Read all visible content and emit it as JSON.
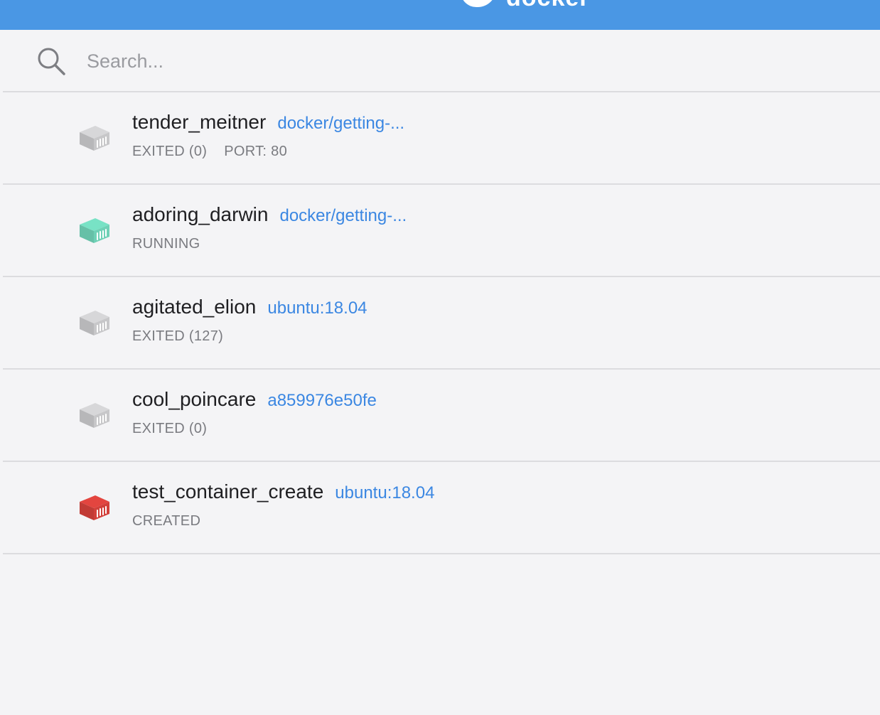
{
  "header": {
    "brand": "docker",
    "color": "#4a97e4"
  },
  "search": {
    "placeholder": "Search...",
    "value": ""
  },
  "containers": [
    {
      "name": "tender_meitner",
      "image": "docker/getting-...",
      "status": "EXITED (0)",
      "port": "PORT: 80",
      "icon": "container-icon",
      "color": "#c7c7c9"
    },
    {
      "name": "adoring_darwin",
      "image": "docker/getting-...",
      "status": "RUNNING",
      "port": "",
      "icon": "container-icon",
      "color": "#6fd1b6"
    },
    {
      "name": "agitated_elion",
      "image": "ubuntu:18.04",
      "status": "EXITED (127)",
      "port": "",
      "icon": "container-icon",
      "color": "#c7c7c9"
    },
    {
      "name": "cool_poincare",
      "image": "a859976e50fe",
      "status": "EXITED (0)",
      "port": "",
      "icon": "container-icon",
      "color": "#c7c7c9"
    },
    {
      "name": "test_container_create",
      "image": "ubuntu:18.04",
      "status": "CREATED",
      "port": "",
      "icon": "container-icon",
      "color": "#d2403a"
    }
  ]
}
